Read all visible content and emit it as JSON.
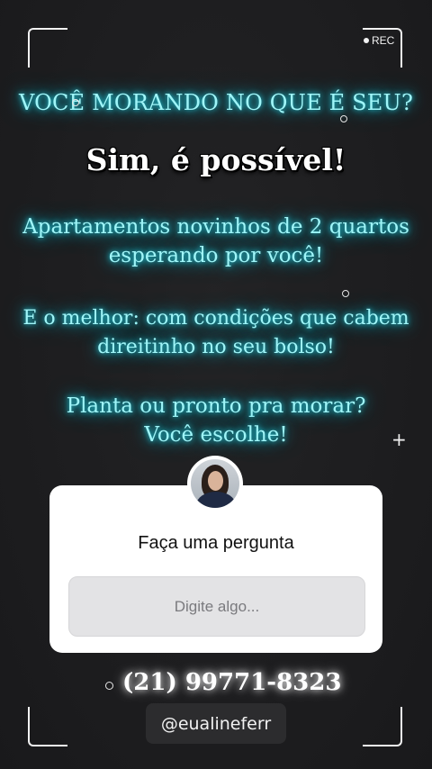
{
  "recording": {
    "label": "REC"
  },
  "caption": {
    "line1": "VOCÊ MORANDO NO QUE É SEU?",
    "headline": "Sim, é possível!",
    "para1_a": "Apartamentos novinhos de 2 quartos",
    "para1_b": "esperando por você!",
    "para2_a": "E o melhor: com condições que cabem",
    "para2_b": "direitinho no seu bolso!",
    "para3_a": "Planta ou pronto pra morar?",
    "para3_b": "Você escolhe!"
  },
  "question_sticker": {
    "prompt": "Faça uma pergunta",
    "placeholder": "Digite algo..."
  },
  "contact": {
    "phone": "(21) 99771-8323",
    "handle": "@eualineferr"
  },
  "colors": {
    "background": "#1c1c1e",
    "neon_text": "#9ff5f8",
    "neon_glow": "#24d6e6",
    "card": "#ffffff",
    "input_bg": "#e3e3e5"
  },
  "icons": [
    "rec-dot-icon",
    "plus-icon",
    "avatar"
  ]
}
